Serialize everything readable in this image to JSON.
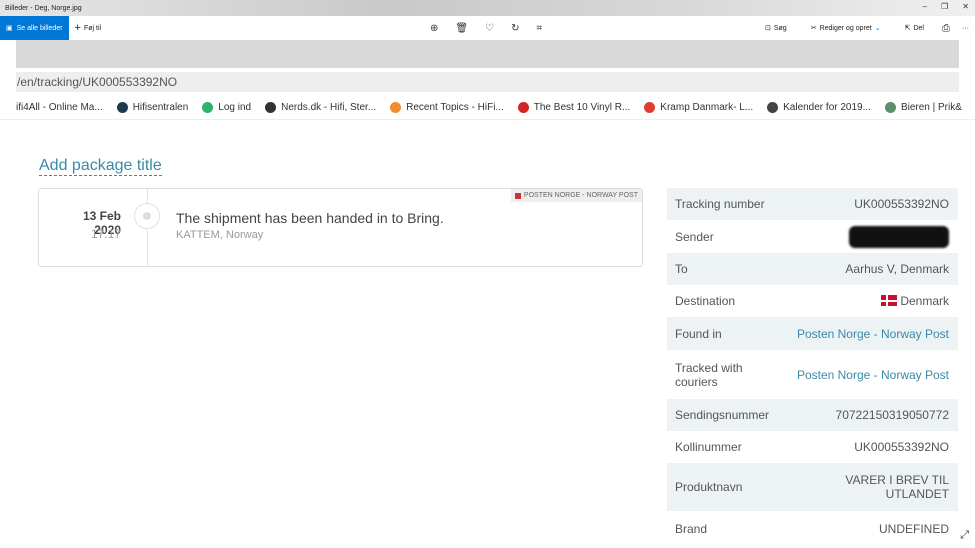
{
  "window": {
    "title": "Billeder - Deg, Norge.jpg",
    "minimize": "–",
    "restore": "❐",
    "close": "✕"
  },
  "toolbar": {
    "see_all": "Se alle billeder",
    "add": "Føj til",
    "search": "Søg",
    "edit": "Rediger og opret",
    "share": "Del",
    "more": "···"
  },
  "browser": {
    "url": "/en/tracking/UK000553392NO",
    "bookmarks": [
      {
        "label": "ifi4All - Online Ma...",
        "color": "#ffffff"
      },
      {
        "label": "Hifisentralen",
        "color": "#1e3a4c"
      },
      {
        "label": "Log ind",
        "color": "#2db36b"
      },
      {
        "label": "Nerds.dk - Hifi, Ster...",
        "color": "#333333"
      },
      {
        "label": "Recent Topics - HiFi...",
        "color": "#f28c28"
      },
      {
        "label": "The Best 10 Vinyl R...",
        "color": "#d32323"
      },
      {
        "label": "Kramp Danmark- L...",
        "color": "#e03c31"
      },
      {
        "label": "Kalender for 2019...",
        "color": "#444444"
      },
      {
        "label": "Bieren | Prik&",
        "color": "#5a8f6a"
      }
    ]
  },
  "page": {
    "add_title": "Add package title",
    "event": {
      "date": "13 Feb 2020",
      "time": "17:17",
      "message": "The shipment has been handed in to Bring.",
      "location": "KATTEM, Norway",
      "courier": "POSTEN NORGE - NORWAY POST"
    },
    "details": [
      {
        "label": "Tracking number",
        "value": "UK000553392NO"
      },
      {
        "label": "Sender",
        "value": ""
      },
      {
        "label": "To",
        "value": "Aarhus V, Denmark"
      },
      {
        "label": "Destination",
        "value": "Denmark"
      },
      {
        "label": "Found in",
        "value": "Posten Norge - Norway Post"
      },
      {
        "label": "Tracked with couriers",
        "value": "Posten Norge - Norway Post"
      },
      {
        "label": "Sendingsnummer",
        "value": "70722150319050772"
      },
      {
        "label": "Kollinummer",
        "value": "UK000553392NO"
      },
      {
        "label": "Produktnavn",
        "value": "VARER I BREV TIL UTLANDET"
      },
      {
        "label": "Brand",
        "value": "UNDEFINED"
      }
    ]
  }
}
